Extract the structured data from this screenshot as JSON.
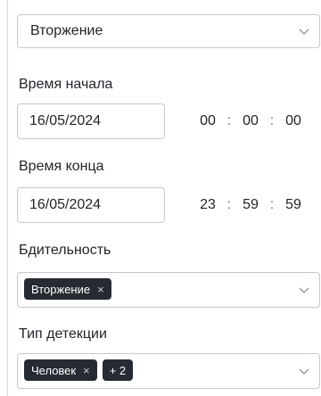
{
  "mode_select": {
    "value": "Вторжение"
  },
  "start": {
    "label": "Время начала",
    "date": "16/05/2024",
    "hh": "00",
    "mm": "00",
    "ss": "00"
  },
  "end": {
    "label": "Время конца",
    "date": "16/05/2024",
    "hh": "23",
    "mm": "59",
    "ss": "59"
  },
  "vigilance": {
    "label": "Бдительность",
    "chips": [
      "Вторжение"
    ]
  },
  "detection": {
    "label": "Тип детекции",
    "chips": [
      "Человек"
    ],
    "more": "+ 2"
  },
  "time_separator": ":",
  "remove_glyph": "×"
}
